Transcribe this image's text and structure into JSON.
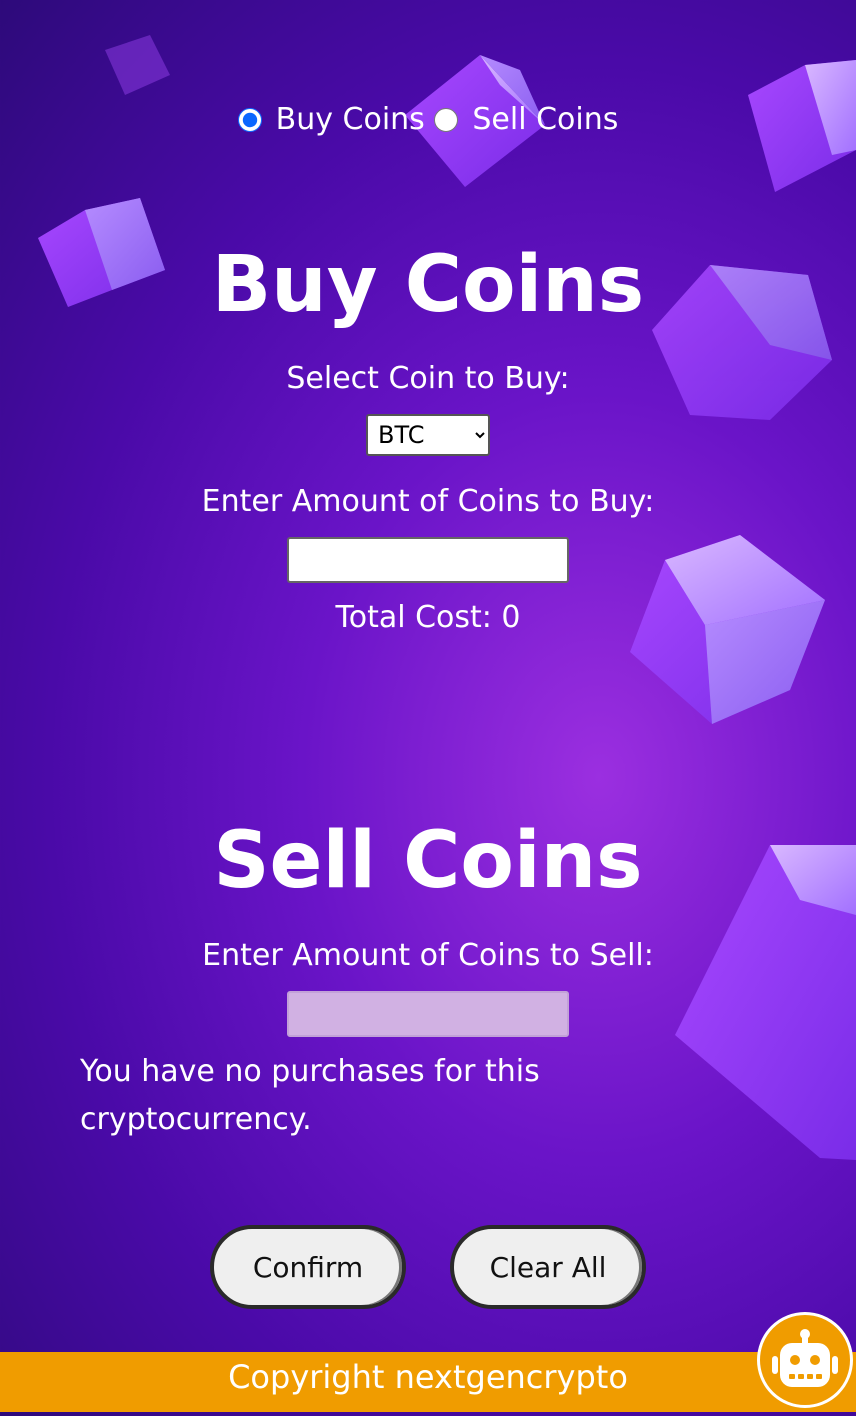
{
  "trade_mode": {
    "buy_label": "Buy Coins",
    "sell_label": "Sell Coins",
    "selected": "buy"
  },
  "buy": {
    "title": "Buy Coins",
    "select_label": "Select Coin to Buy:",
    "coin_options": [
      "BTC"
    ],
    "selected_coin": "BTC",
    "amount_label": "Enter Amount of Coins to Buy:",
    "amount_value": "",
    "total_cost_text": "Total Cost: 0"
  },
  "sell": {
    "title": "Sell Coins",
    "amount_label": "Enter Amount of Coins to Sell:",
    "amount_value": "",
    "message": "You have no purchases for this cryptocurrency."
  },
  "actions": {
    "confirm_label": "Confirm",
    "clear_label": "Clear All"
  },
  "footer": {
    "text": "Copyright nextgencrypto"
  },
  "icons": {
    "chatbot": "robot-icon"
  },
  "colors": {
    "background": "#5a10b8",
    "footer": "#f09c00",
    "cube": "#a35cff",
    "text": "#ffffff",
    "radio_accent": "#0a66ff"
  }
}
